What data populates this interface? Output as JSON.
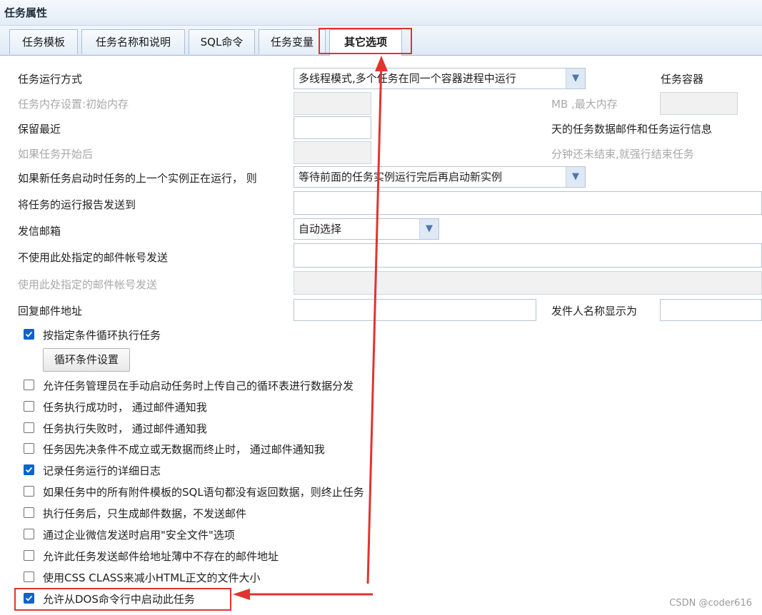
{
  "window": {
    "title": "任务属性"
  },
  "tabs": [
    {
      "label": "任务模板"
    },
    {
      "label": "任务名称和说明"
    },
    {
      "label": "SQL命令"
    },
    {
      "label": "任务变量"
    },
    {
      "label": "其它选项",
      "active": true
    }
  ],
  "form": {
    "run_mode_label": "任务运行方式",
    "run_mode_value": "多线程模式,多个任务在同一个容器进程中运行",
    "container_label": "任务容器",
    "memory_label": "任务内存设置:初始内存",
    "max_memory_label": "MB ,最大内存",
    "keep_label": "保留最近",
    "keep_suffix": "天的任务数据邮件和任务运行信息",
    "timeout_label": "如果任务开始后",
    "timeout_suffix": "分钟还未结束,就强行结束任务",
    "instance_label": "如果新任务启动时任务的上一个实例正在运行， 则",
    "instance_value": "等待前面的任务实例运行完后再启动新实例",
    "report_to_label": "将任务的运行报告发送到",
    "mailbox_label": "发信邮箱",
    "mailbox_value": "自动选择",
    "exclude_accounts_label": "不使用此处指定的邮件帐号发送",
    "use_accounts_label": "使用此处指定的邮件帐号发送",
    "reply_label": "回复邮件地址",
    "sender_name_label": "发件人名称显示为",
    "loop_button": "循环条件设置"
  },
  "options": [
    {
      "label": "按指定条件循环执行任务",
      "checked": true
    },
    {
      "label": "允许任务管理员在手动启动任务时上传自己的循环表进行数据分发",
      "checked": false
    },
    {
      "label": "任务执行成功时， 通过邮件通知我",
      "checked": false
    },
    {
      "label": "任务执行失败时， 通过邮件通知我",
      "checked": false
    },
    {
      "label": "任务因先决条件不成立或无数据而终止时， 通过邮件通知我",
      "checked": false
    },
    {
      "label": "记录任务运行的详细日志",
      "checked": true
    },
    {
      "label": "如果任务中的所有附件模板的SQL语句都没有返回数据，则终止任务",
      "checked": false
    },
    {
      "label": "执行任务后，只生成邮件数据，不发送邮件",
      "checked": false
    },
    {
      "label": "通过企业微信发送时启用\"安全文件\"选项",
      "checked": false
    },
    {
      "label": "允许此任务发送邮件给地址薄中不存在的邮件地址",
      "checked": false
    },
    {
      "label": "使用CSS CLASS来减小HTML正文的文件大小",
      "checked": false
    },
    {
      "label": "允许从DOS命令行中启动此任务",
      "checked": true
    }
  ],
  "watermark": "CSDN @coder616",
  "colors": {
    "accent": "#0a63cf",
    "annotation": "#e2332f"
  }
}
